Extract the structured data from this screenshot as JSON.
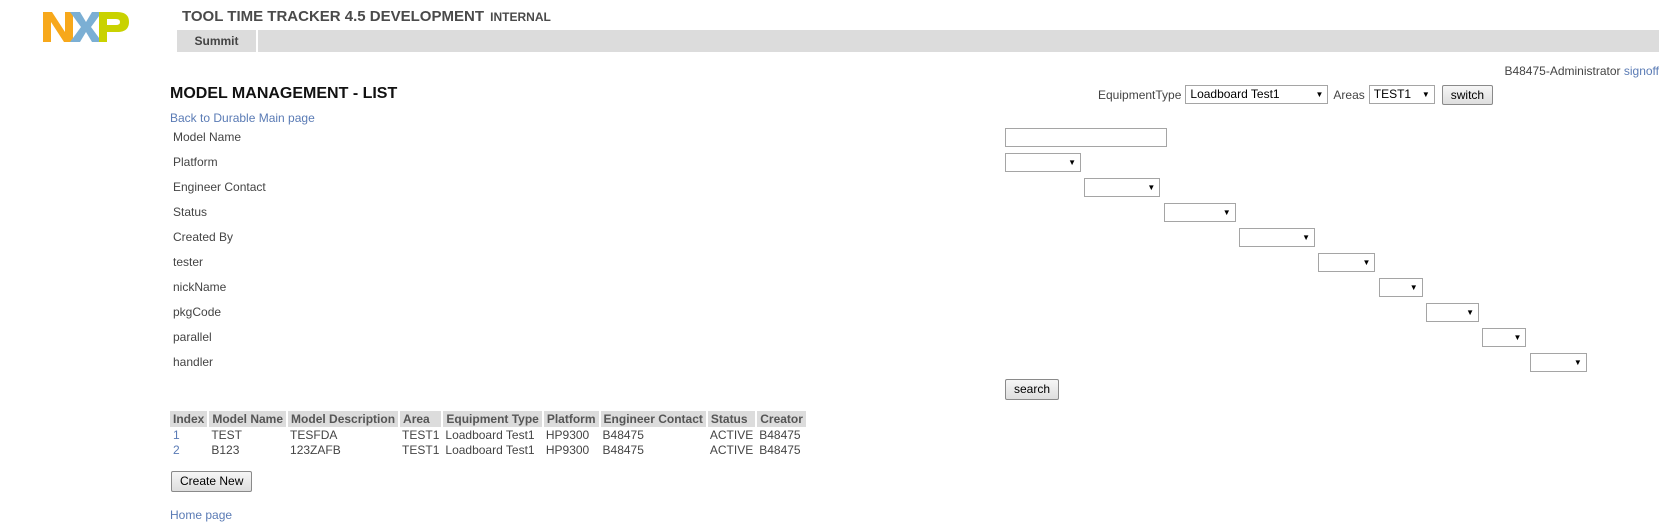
{
  "header": {
    "logo_text": "NXP",
    "title": "TOOL TIME TRACKER 4.5 DEVELOPMENT",
    "subtitle": "INTERNAL",
    "nav_tabs": [
      {
        "label": "Summit"
      }
    ]
  },
  "user": {
    "name": "B48475-Administrator",
    "signoff_label": "signoff"
  },
  "page": {
    "title": "MODEL MANAGEMENT - LIST",
    "back_link": "Back to Durable Main page",
    "home_link": "Home page"
  },
  "equipment_bar": {
    "type_label": "EquipmentType",
    "type_value": "Loadboard Test1",
    "areas_label": "Areas",
    "areas_value": "TEST1",
    "switch_label": "switch"
  },
  "search_form": {
    "fields": [
      {
        "label": "Model Name",
        "kind": "text",
        "value": ""
      },
      {
        "label": "Platform",
        "kind": "select",
        "value": ""
      },
      {
        "label": "Engineer Contact",
        "kind": "select",
        "value": ""
      },
      {
        "label": "Status",
        "kind": "select",
        "value": ""
      },
      {
        "label": "Created By",
        "kind": "select",
        "value": ""
      },
      {
        "label": "tester",
        "kind": "select",
        "value": ""
      },
      {
        "label": "nickName",
        "kind": "select",
        "value": ""
      },
      {
        "label": "pkgCode",
        "kind": "select",
        "value": ""
      },
      {
        "label": "parallel",
        "kind": "select",
        "value": ""
      },
      {
        "label": "handler",
        "kind": "select",
        "value": ""
      }
    ],
    "search_label": "search"
  },
  "results": {
    "columns": [
      "Index",
      "Model Name",
      "Model Description",
      "Area",
      "Equipment Type",
      "Platform",
      "Engineer Contact",
      "Status",
      "Creator"
    ],
    "rows": [
      [
        "1",
        "TEST",
        "TESFDA",
        "TEST1",
        "Loadboard Test1",
        "HP9300",
        "B48475",
        "ACTIVE",
        "B48475"
      ],
      [
        "2",
        "B123",
        "123ZAFB",
        "TEST1",
        "Loadboard Test1",
        "HP9300",
        "B48475",
        "ACTIVE",
        "B48475"
      ]
    ]
  },
  "create_new_label": "Create New",
  "colors": {
    "logo_n": "#f7a81b",
    "logo_x": "#7bafd4",
    "logo_p": "#c9d200",
    "link": "#5a7bb5",
    "nav_bg": "#dcdcdc"
  }
}
